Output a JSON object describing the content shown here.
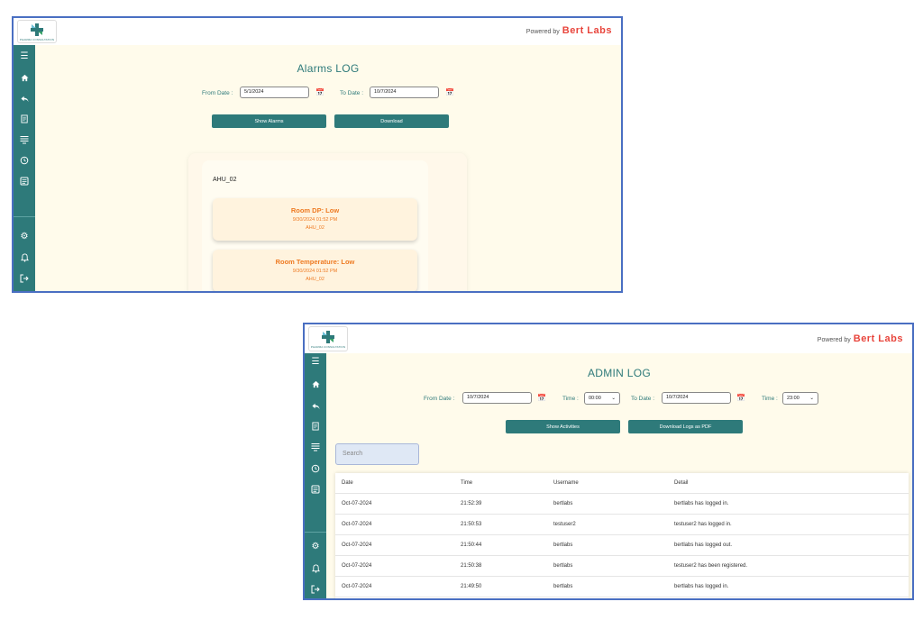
{
  "brand": {
    "powered_by": "Powered by",
    "brand_name": "Bert Labs",
    "logo_text": "PHARMA CONSULTATION",
    "brand_color": "#e8453c",
    "accent": "#2e7a7a"
  },
  "sidebar": {
    "top_icons": [
      "menu-icon",
      "home-icon",
      "back-icon",
      "report-icon",
      "filter-icon",
      "history-icon",
      "log-icon"
    ],
    "bottom_icons": [
      "settings-icon",
      "bell-icon",
      "logout-icon"
    ]
  },
  "alarms": {
    "title": "Alarms LOG",
    "from_label": "From Date :",
    "from_value": "5/1/2024",
    "to_label": "To Date :",
    "to_value": "10/7/2024",
    "show_btn": "Show Alarms",
    "download_btn": "Download",
    "device": "AHU_02",
    "cards": [
      {
        "title": "Room DP: Low",
        "datetime": "9/30/2024 01:52 PM",
        "device": "AHU_02"
      },
      {
        "title": "Room Temperature: Low",
        "datetime": "9/30/2024 01:52 PM",
        "device": "AHU_02"
      }
    ]
  },
  "admin": {
    "title": "ADMIN LOG",
    "from_label": "From Date :",
    "from_value": "10/7/2024",
    "time1_label": "Time :",
    "time1_value": "00:00",
    "to_label": "To Date :",
    "to_value": "10/7/2024",
    "time2_label": "Time :",
    "time2_value": "23:00",
    "show_btn": "Show Activities",
    "download_btn": "Download Logs as PDF",
    "search_placeholder": "Search",
    "columns": [
      "Date",
      "Time",
      "Username",
      "Detail"
    ],
    "rows": [
      [
        "Oct-07-2024",
        "21:52:39",
        "bertlabs",
        "bertlabs has logged in."
      ],
      [
        "Oct-07-2024",
        "21:50:53",
        "testuser2",
        "testuser2 has logged in."
      ],
      [
        "Oct-07-2024",
        "21:50:44",
        "bertlabs",
        "bertlabs has logged out."
      ],
      [
        "Oct-07-2024",
        "21:50:38",
        "bertlabs",
        "testuser2 has been registered."
      ],
      [
        "Oct-07-2024",
        "21:49:50",
        "bertlabs",
        "bertlabs has logged in."
      ]
    ]
  }
}
